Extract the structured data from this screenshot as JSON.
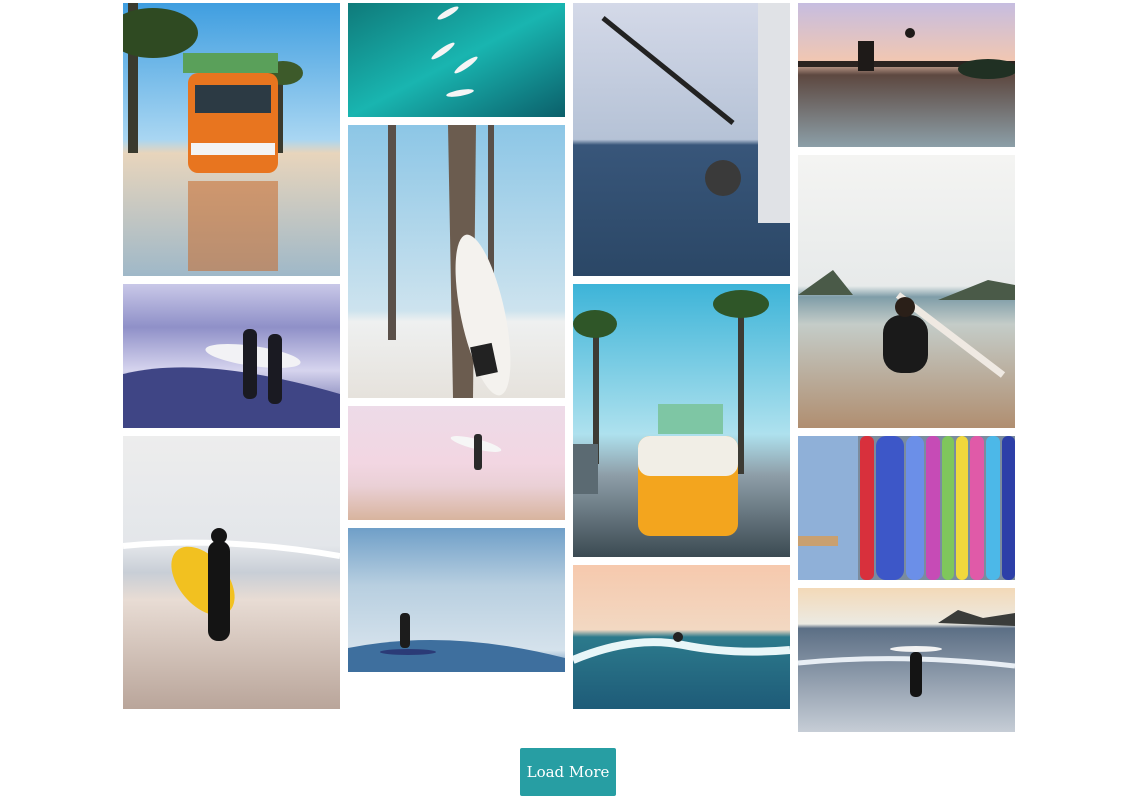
{
  "gallery": {
    "photos": [
      {
        "subject": "orange-van-palms"
      },
      {
        "subject": "surfers-aerial"
      },
      {
        "subject": "fishing-rod-sea"
      },
      {
        "subject": "pier-jump-sunset"
      },
      {
        "subject": "two-surfers-walking"
      },
      {
        "subject": "surfboard-palm-tree"
      },
      {
        "subject": "surfer-sitting-beach"
      },
      {
        "subject": "surfer-carrying-yellow-board"
      },
      {
        "subject": "surfer-pink-beach"
      },
      {
        "subject": "yellow-van-surfboards"
      },
      {
        "subject": "colorful-surfboards-rack"
      },
      {
        "subject": "surfer-riding-wave"
      },
      {
        "subject": "wave-sunset-surfer"
      },
      {
        "subject": "surfer-board-overhead"
      }
    ]
  },
  "load_more": {
    "label": "Load More",
    "color": "#279ea3"
  }
}
